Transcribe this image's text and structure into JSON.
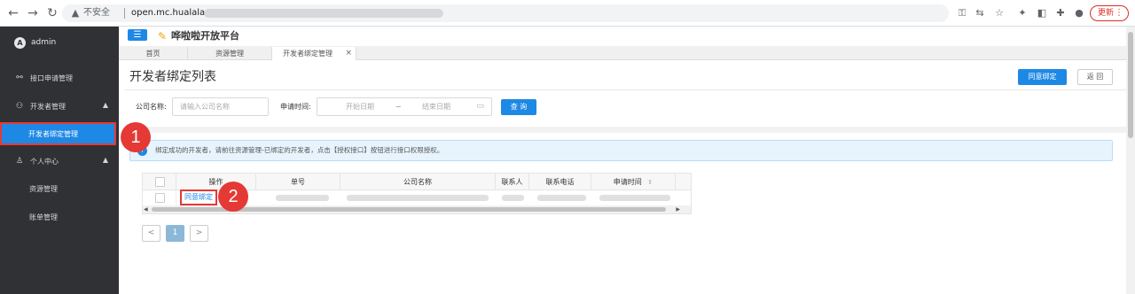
{
  "browser": {
    "insecure_label": "不安全",
    "url": "open.mc.hualala.con",
    "update_label": "更新"
  },
  "sidebar": {
    "user": "admin",
    "items": [
      {
        "label": "接口申请管理",
        "icon": "link-icon"
      },
      {
        "label": "开发者管理",
        "icon": "users-icon"
      },
      {
        "label": "开发者绑定管理",
        "active": true
      },
      {
        "label": "个人中心",
        "icon": "user-icon"
      },
      {
        "label": "资源管理"
      },
      {
        "label": "账单管理"
      }
    ]
  },
  "header": {
    "platform_title": "哗啦啦开放平台"
  },
  "tabs": [
    {
      "label": "首页"
    },
    {
      "label": "资源管理"
    },
    {
      "label": "开发者绑定管理",
      "active": true
    }
  ],
  "page": {
    "title": "开发者绑定列表",
    "apply_bind_label": "同意绑定",
    "back_label": "返 回"
  },
  "filters": {
    "company_label": "公司名称:",
    "company_placeholder": "请输入公司名称",
    "apply_time_label": "申请时间:",
    "start_placeholder": "开始日期",
    "range_sep": "~",
    "end_placeholder": "结束日期",
    "query_label": "查 询"
  },
  "notice": {
    "text": "绑定成功的开发者，请前往资源管理-已绑定的开发者，点击【授权接口】按钮进行接口权限授权。"
  },
  "table": {
    "columns": [
      "操作",
      "单号",
      "公司名称",
      "联系人",
      "联系电话",
      "申请时间"
    ],
    "rows": [
      {
        "action": "同意绑定"
      }
    ]
  },
  "pagination": {
    "prev": "<",
    "current": "1",
    "next": ">"
  },
  "markers": [
    "1",
    "2"
  ]
}
